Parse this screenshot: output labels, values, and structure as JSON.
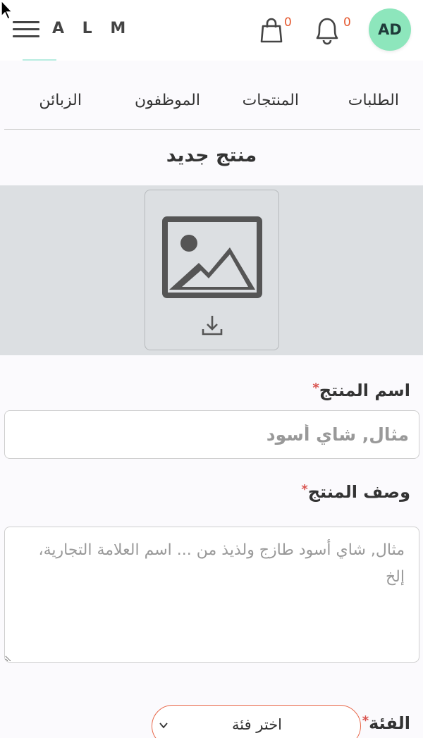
{
  "header": {
    "logo": "A L M",
    "cart_count": "0",
    "notification_count": "0",
    "avatar_initials": "AD"
  },
  "tabs": [
    {
      "label": "الطلبات"
    },
    {
      "label": "المنتجات"
    },
    {
      "label": "الموظفون"
    },
    {
      "label": "الزبائن"
    }
  ],
  "page_title": "منتج جديد",
  "form": {
    "name_label": "اسم المنتج",
    "name_placeholder": "مثال, شاي أسود",
    "description_label": "وصف المنتج",
    "description_placeholder": "مثال, شاي أسود طازج ولذيذ من ... اسم العلامة التجارية، إلخ",
    "category_label": "الفئة",
    "category_select": "اختر فئة",
    "required_mark": "*"
  },
  "colors": {
    "avatar_bg": "#8de6bc",
    "required": "#d9534f",
    "badge": "#e4572e",
    "select_border": "#e8684a"
  }
}
